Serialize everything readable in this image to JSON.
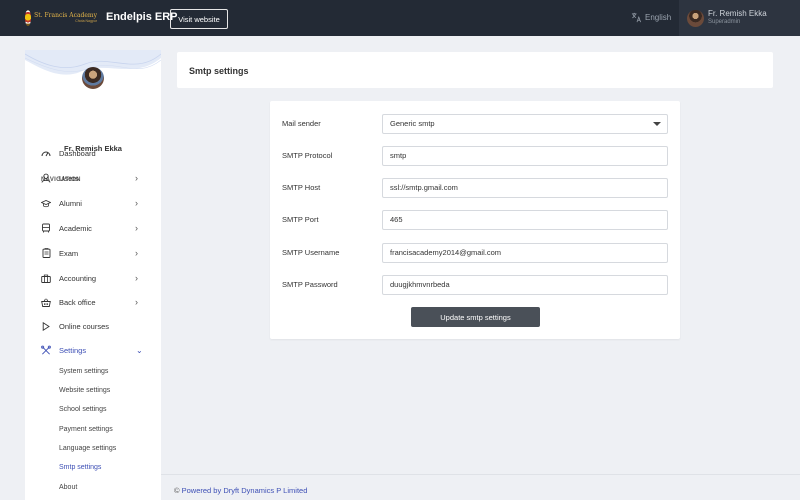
{
  "header": {
    "logo_line1": "St. Francis Academy",
    "logo_line2": "Chota Nagpur",
    "brand": "Endelpis ERP",
    "visit_label": "Visit website",
    "language": "English",
    "user_name": "Fr. Remish Ekka",
    "user_role": "Superadmin"
  },
  "sidebar": {
    "profile_name": "Fr. Remish Ekka",
    "nav_heading": "NAVIGATION",
    "items": [
      {
        "label": "Dashboard",
        "icon": "dashboard-gauge-icon",
        "has_chevron": false
      },
      {
        "label": "Users",
        "icon": "user-icon",
        "has_chevron": true
      },
      {
        "label": "Alumni",
        "icon": "graduation-cap-icon",
        "has_chevron": true
      },
      {
        "label": "Academic",
        "icon": "bus-icon",
        "has_chevron": true
      },
      {
        "label": "Exam",
        "icon": "clipboard-icon",
        "has_chevron": true
      },
      {
        "label": "Accounting",
        "icon": "briefcase-icon",
        "has_chevron": true
      },
      {
        "label": "Back office",
        "icon": "basket-icon",
        "has_chevron": true
      },
      {
        "label": "Online courses",
        "icon": "play-icon",
        "has_chevron": false
      },
      {
        "label": "Settings",
        "icon": "tools-icon",
        "has_chevron": true,
        "expanded": true
      }
    ],
    "settings_sub": [
      {
        "label": "System settings"
      },
      {
        "label": "Website settings"
      },
      {
        "label": "School settings"
      },
      {
        "label": "Payment settings"
      },
      {
        "label": "Language settings"
      },
      {
        "label": "Smtp settings",
        "active": true
      },
      {
        "label": "About"
      }
    ]
  },
  "page": {
    "title": "Smtp settings"
  },
  "form": {
    "mail_sender_label": "Mail sender",
    "mail_sender_value": "Generic smtp",
    "protocol_label": "SMTP Protocol",
    "protocol_value": "smtp",
    "host_label": "SMTP Host",
    "host_value": "ssl://smtp.gmail.com",
    "port_label": "SMTP Port",
    "port_value": "465",
    "username_label": "SMTP Username",
    "username_value": "francisacademy2014@gmail.com",
    "password_label": "SMTP Password",
    "password_value": "duugjkhmvnrbeda",
    "submit_label": "Update smtp settings"
  },
  "footer": {
    "copyright": "©",
    "text": "Powered by Dryft Dynamics P Limited"
  },
  "colors": {
    "topbar": "#232a35",
    "accent": "#3d4fb5",
    "button": "#4a5058",
    "page_bg": "#eef0f4"
  }
}
